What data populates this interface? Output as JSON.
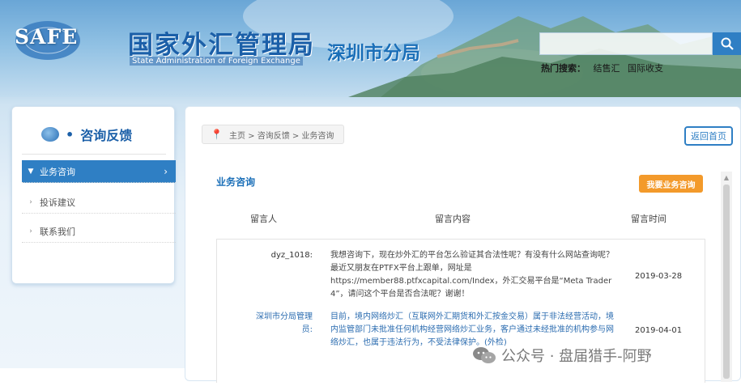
{
  "header": {
    "logo_text": "SAFE",
    "org_name_cn": "国家外汇管理局",
    "org_name_en": "State Administration of Foreign Exchange",
    "branch": "深圳市分局",
    "search": {
      "value": "",
      "button_icon": "search-icon"
    },
    "hot_search": {
      "label": "热门搜索：",
      "links": [
        "结售汇",
        "国际收支"
      ]
    }
  },
  "sidebar": {
    "title": "咨询反馈",
    "title_dot": "•",
    "items": [
      {
        "label": "业务咨询",
        "active": true
      },
      {
        "label": "投诉建议",
        "active": false
      },
      {
        "label": "联系我们",
        "active": false
      }
    ]
  },
  "breadcrumb": {
    "text": "主页 > 咨询反馈 > 业务咨询"
  },
  "home_button": "返回首页",
  "section": {
    "title": "业务咨询",
    "ask_button": "我要业务咨询",
    "columns": [
      "留言人",
      "留言内容",
      "留言时间"
    ],
    "rows": [
      {
        "name": "dyz_1018:",
        "content": "我想咨询下，现在炒外汇的平台怎么验证其合法性呢？有没有什么网站查询呢？最近又朋友在PTFX平台上跟单，网址是https://member88.ptfxcapital.com/Index，外汇交易平台是“Meta Trader 4”，请问这个平台是否合法呢？谢谢！",
        "date": "2019-03-28"
      },
      {
        "name": "深圳市分局管理员:",
        "content": "目前，境内网络炒汇（互联网外汇期货和外汇按金交易）属于非法经营活动，境内监管部门未批准任何机构经营网络炒汇业务，客户通过未经批准的机构参与网络炒汇，也属于违法行为，不受法律保护。(外检)",
        "date": "2019-04-01"
      }
    ]
  },
  "watermark": {
    "text": "公众号 · 盘届猎手-阿野"
  },
  "colors": {
    "brand_blue": "#1b5fa8",
    "accent_blue": "#2f7fc4",
    "orange": "#f39a2b"
  }
}
